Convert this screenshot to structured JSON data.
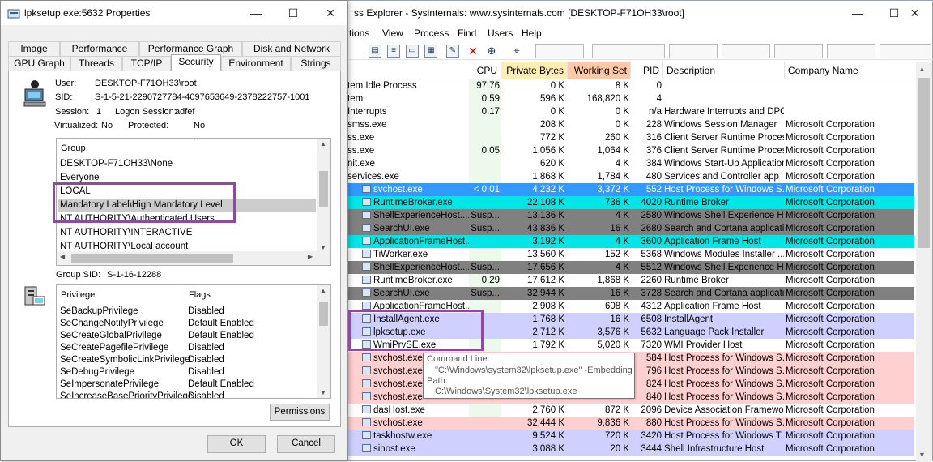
{
  "main": {
    "title": "ss Explorer - Sysinternals: www.sysinternals.com [DESKTOP-F71OH33\\root]",
    "caption_buttons": [
      "—",
      "☐",
      "✕"
    ],
    "menus": [
      "tions",
      "View",
      "Process",
      "Find",
      "Users",
      "Help"
    ],
    "columns": [
      "CPU",
      "Private Bytes",
      "Working Set",
      "PID",
      "Description",
      "Company Name"
    ],
    "colors": {
      "private_bytes_header": "#ffedb3",
      "working_set_header": "#ffc9a8",
      "cpu_col": "#eef9ee"
    },
    "rows": [
      {
        "name": "tem Idle Process",
        "cpu": "97.76",
        "pb": "0 K",
        "ws": "8 K",
        "pid": "0",
        "desc": "",
        "company": "",
        "bg": "",
        "icon": false
      },
      {
        "name": "tem",
        "cpu": "0.59",
        "pb": "596 K",
        "ws": "168,820 K",
        "pid": "4",
        "desc": "",
        "company": "",
        "bg": "",
        "icon": false
      },
      {
        "name": "Interrupts",
        "cpu": "0.17",
        "pb": "0 K",
        "ws": "0 K",
        "pid": "n/a",
        "desc": "Hardware Interrupts and DPCs",
        "company": "",
        "bg": "",
        "icon": false
      },
      {
        "name": "smss.exe",
        "cpu": "",
        "pb": "208 K",
        "ws": "0 K",
        "pid": "228",
        "desc": "Windows Session Manager",
        "company": "Microsoft Corporation",
        "bg": "",
        "icon": false
      },
      {
        "name": "ss.exe",
        "cpu": "",
        "pb": "772 K",
        "ws": "260 K",
        "pid": "316",
        "desc": "Client Server Runtime Process",
        "company": "Microsoft Corporation",
        "bg": "",
        "icon": false
      },
      {
        "name": "ss.exe",
        "cpu": "0.05",
        "pb": "1,056 K",
        "ws": "1,064 K",
        "pid": "376",
        "desc": "Client Server Runtime Process",
        "company": "Microsoft Corporation",
        "bg": "",
        "icon": false
      },
      {
        "name": "nit.exe",
        "cpu": "",
        "pb": "620 K",
        "ws": "4 K",
        "pid": "384",
        "desc": "Windows Start-Up Application",
        "company": "Microsoft Corporation",
        "bg": "",
        "icon": false
      },
      {
        "name": "services.exe",
        "cpu": "",
        "pb": "1,868 K",
        "ws": "1,784 K",
        "pid": "480",
        "desc": "Services and Controller app",
        "company": "Microsoft Corporation",
        "bg": "",
        "icon": false
      },
      {
        "name": "svchost.exe",
        "cpu": "< 0.01",
        "pb": "4,232 K",
        "ws": "3,372 K",
        "pid": "552",
        "desc": "Host Process for Windows S...",
        "company": "Microsoft Corporation",
        "bg": "#3399ff",
        "fg": "#ffffff",
        "icon": true
      },
      {
        "name": "RuntimeBroker.exe",
        "cpu": "",
        "pb": "22,108 K",
        "ws": "736 K",
        "pid": "4020",
        "desc": "Runtime Broker",
        "company": "Microsoft Corporation",
        "bg": "#00e5e5",
        "icon": true
      },
      {
        "name": "ShellExperienceHost....",
        "cpu": "Susp...",
        "pb": "13,136 K",
        "ws": "4 K",
        "pid": "2580",
        "desc": "Windows Shell Experience H...",
        "company": "Microsoft Corporation",
        "bg": "#808080",
        "icon": true
      },
      {
        "name": "SearchUI.exe",
        "cpu": "Susp...",
        "pb": "43,836 K",
        "ws": "16 K",
        "pid": "2680",
        "desc": "Search and Cortana applicati...",
        "company": "Microsoft Corporation",
        "bg": "#808080",
        "icon": true
      },
      {
        "name": "ApplicationFrameHost....",
        "cpu": "",
        "pb": "3,192 K",
        "ws": "4 K",
        "pid": "3600",
        "desc": "Application Frame Host",
        "company": "Microsoft Corporation",
        "bg": "#00e5e5",
        "icon": true
      },
      {
        "name": "TiWorker.exe",
        "cpu": "",
        "pb": "13,560 K",
        "ws": "152 K",
        "pid": "5368",
        "desc": "Windows Modules Installer ...",
        "company": "Microsoft Corporation",
        "bg": "",
        "icon": true
      },
      {
        "name": "ShellExperienceHost....",
        "cpu": "Susp...",
        "pb": "17,656 K",
        "ws": "4 K",
        "pid": "5512",
        "desc": "Windows Shell Experience H...",
        "company": "Microsoft Corporation",
        "bg": "#808080",
        "icon": true
      },
      {
        "name": "RuntimeBroker.exe",
        "cpu": "0.29",
        "pb": "17,612 K",
        "ws": "1,868 K",
        "pid": "2260",
        "desc": "Runtime Broker",
        "company": "Microsoft Corporation",
        "bg": "",
        "icon": true
      },
      {
        "name": "SearchUI.exe",
        "cpu": "Susp...",
        "pb": "32,944 K",
        "ws": "16 K",
        "pid": "3728",
        "desc": "Search and Cortana applicati...",
        "company": "Microsoft Corporation",
        "bg": "#808080",
        "icon": true
      },
      {
        "name": "ApplicationFrameHost....",
        "cpu": "",
        "pb": "2,908 K",
        "ws": "608 K",
        "pid": "4312",
        "desc": "Application Frame Host",
        "company": "Microsoft Corporation",
        "bg": "",
        "icon": true
      },
      {
        "name": "InstallAgent.exe",
        "cpu": "",
        "pb": "1,768 K",
        "ws": "16 K",
        "pid": "6508",
        "desc": "InstallAgent",
        "company": "Microsoft Corporation",
        "bg": "#d0d0ff",
        "icon": true
      },
      {
        "name": "lpksetup.exe",
        "cpu": "",
        "pb": "2,712 K",
        "ws": "3,576 K",
        "pid": "5632",
        "desc": "Language Pack Installer",
        "company": "Microsoft Corporation",
        "bg": "#d0d0ff",
        "icon": true
      },
      {
        "name": "WmiPrvSE.exe",
        "cpu": "",
        "pb": "1,792 K",
        "ws": "5,020 K",
        "pid": "7320",
        "desc": "WMI Provider Host",
        "company": "Microsoft Corporation",
        "bg": "",
        "icon": true
      },
      {
        "name": "svchost.exe",
        "cpu": "",
        "pb": "",
        "ws": "",
        "pid": "584",
        "desc": "Host Process for Windows S...",
        "company": "Microsoft Corporation",
        "bg": "#ffd0d0",
        "icon": true
      },
      {
        "name": "svchost.exe",
        "cpu": "",
        "pb": "",
        "ws": "",
        "pid": "796",
        "desc": "Host Process for Windows S...",
        "company": "Microsoft Corporation",
        "bg": "#ffd0d0",
        "icon": true
      },
      {
        "name": "svchost.exe",
        "cpu": "",
        "pb": "",
        "ws": "",
        "pid": "824",
        "desc": "Host Process for Windows S...",
        "company": "Microsoft Corporation",
        "bg": "#ffd0d0",
        "icon": true
      },
      {
        "name": "svchost.exe",
        "cpu": "",
        "pb": "",
        "ws": "",
        "pid": "840",
        "desc": "Host Process for Windows S...",
        "company": "Microsoft Corporation",
        "bg": "#ffd0d0",
        "icon": true
      },
      {
        "name": "dasHost.exe",
        "cpu": "",
        "pb": "2,760 K",
        "ws": "872 K",
        "pid": "2096",
        "desc": "Device Association Framewo...",
        "company": "Microsoft Corporation",
        "bg": "",
        "icon": true
      },
      {
        "name": "svchost.exe",
        "cpu": "",
        "pb": "32,444 K",
        "ws": "9,836 K",
        "pid": "880",
        "desc": "Host Process for Windows S...",
        "company": "Microsoft Corporation",
        "bg": "#ffd0d0",
        "icon": true
      },
      {
        "name": "taskhostw.exe",
        "cpu": "",
        "pb": "9,524 K",
        "ws": "720 K",
        "pid": "3420",
        "desc": "Host Process for Windows T...",
        "company": "Microsoft Corporation",
        "bg": "#d0d0ff",
        "icon": true
      },
      {
        "name": "sihost.exe",
        "cpu": "",
        "pb": "3,088 K",
        "ws": "20 K",
        "pid": "3444",
        "desc": "Shell Infrastructure Host",
        "company": "Microsoft Corporation",
        "bg": "#d0d0ff",
        "icon": true
      }
    ],
    "tooltip": {
      "line1": "Command Line:",
      "line2": "\"C:\\Windows\\system32\\lpksetup.exe\" -Embedding",
      "line3": "Path:",
      "line4": "C:\\Windows\\System32\\lpksetup.exe"
    }
  },
  "dialog": {
    "title": "lpksetup.exe:5632 Properties",
    "tabs_row1": [
      "Image",
      "Performance",
      "Performance Graph",
      "Disk and Network"
    ],
    "tabs_row2": [
      "GPU Graph",
      "Threads",
      "TCP/IP",
      "Security",
      "Environment",
      "Strings"
    ],
    "active_tab": "Security",
    "user_label": "User:",
    "user_value": "DESKTOP-F71OH33\\root",
    "sid_label": "SID:",
    "sid_value": "S-1-5-21-2290727784-4097653649-2378222757-1001",
    "session_label": "Session:",
    "session_value": "1",
    "logon_label": "Logon Session:",
    "logon_value": "adfef",
    "virtualized_label": "Virtualized:",
    "virtualized_value": "No",
    "protected_label": "Protected:",
    "protected_value": "No",
    "group_header": "Group",
    "groups": [
      "DESKTOP-F71OH33\\None",
      "Everyone",
      "LOCAL",
      "Mandatory Label\\High Mandatory Level",
      "NT AUTHORITY\\Authenticated Users",
      "NT AUTHORITY\\INTERACTIVE",
      "NT AUTHORITY\\Local account"
    ],
    "selected_group": "Mandatory Label\\High Mandatory Level",
    "group_sid_label": "Group SID:",
    "group_sid_value": "S-1-16-12288",
    "priv_header": "Privilege",
    "flags_header": "Flags",
    "privileges": [
      {
        "name": "SeBackupPrivilege",
        "flags": "Disabled"
      },
      {
        "name": "SeChangeNotifyPrivilege",
        "flags": "Default Enabled"
      },
      {
        "name": "SeCreateGlobalPrivilege",
        "flags": "Default Enabled"
      },
      {
        "name": "SeCreatePagefilePrivilege",
        "flags": "Disabled"
      },
      {
        "name": "SeCreateSymbolicLinkPrivilege",
        "flags": "Disabled"
      },
      {
        "name": "SeDebugPrivilege",
        "flags": "Disabled"
      },
      {
        "name": "SeImpersonatePrivilege",
        "flags": "Default Enabled"
      },
      {
        "name": "SeIncreaseBasePriorityPrivilege",
        "flags": "Disabled"
      }
    ],
    "permissions_button": "Permissions",
    "ok_button": "OK",
    "cancel_button": "Cancel",
    "highlight_color": "#8e4a9e"
  }
}
